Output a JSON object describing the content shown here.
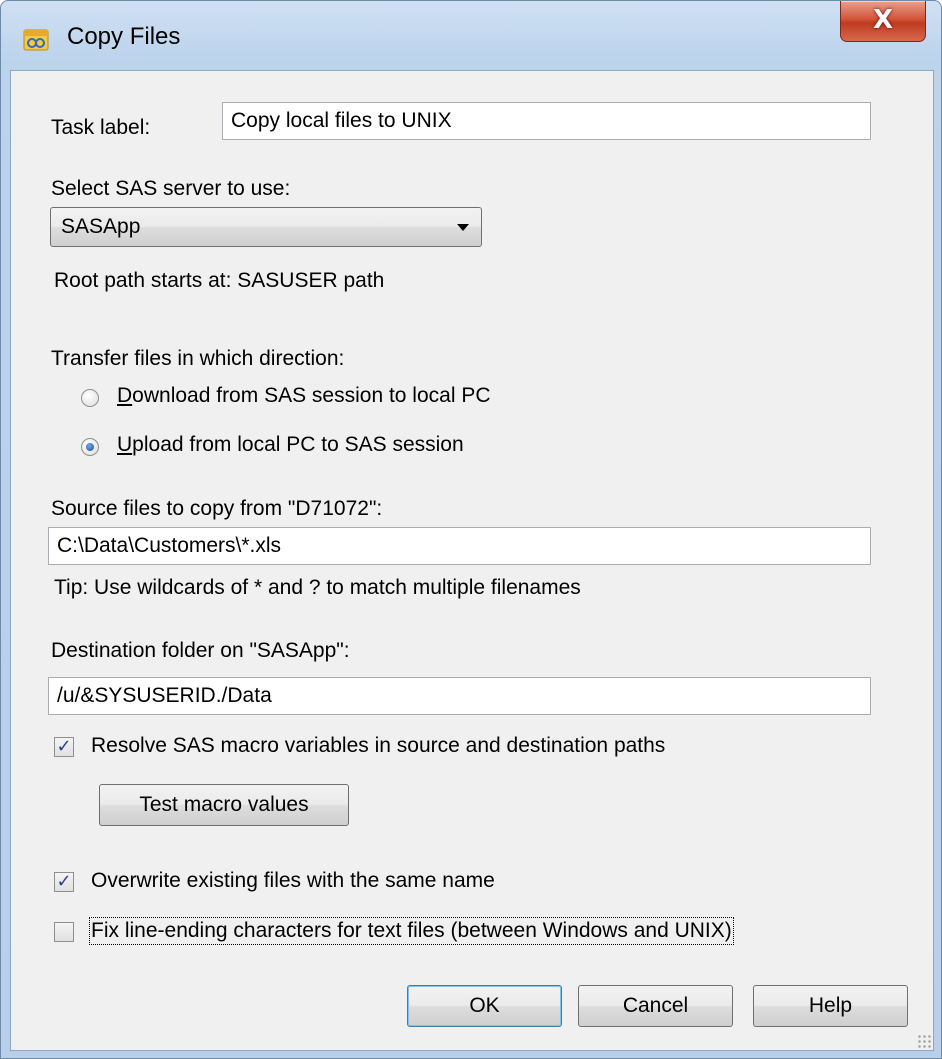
{
  "window": {
    "title": "Copy Files",
    "close_glyph": "X"
  },
  "task_label": {
    "label": "Task label:",
    "value": "Copy local files to UNIX"
  },
  "server": {
    "label": "Select SAS server to use:",
    "selected": "SASApp",
    "root_path_note": "Root path starts at: SASUSER path"
  },
  "direction": {
    "label": "Transfer files in which direction:",
    "options": [
      {
        "mnemonic": "D",
        "rest": "ownload from SAS session to local PC",
        "checked": false
      },
      {
        "mnemonic": "U",
        "rest": "pload from local PC to SAS session",
        "checked": true
      }
    ]
  },
  "source": {
    "label": "Source files to copy from \"D71072\":",
    "value": "C:\\Data\\Customers\\*.xls",
    "tip": "Tip: Use wildcards of * and ? to match multiple filenames"
  },
  "destination": {
    "label": "Destination folder on \"SASApp\":",
    "value": "/u/&SYSUSERID./Data"
  },
  "options": {
    "resolve_macros": {
      "label": "Resolve SAS macro variables in source and destination paths",
      "checked": true
    },
    "test_button": "Test macro values",
    "overwrite": {
      "label": "Overwrite existing files with the same name",
      "checked": true
    },
    "fix_line_endings": {
      "label": "Fix line-ending characters for text files (between Windows and UNIX)",
      "checked": false
    }
  },
  "buttons": {
    "ok": "OK",
    "cancel": "Cancel",
    "help": "Help"
  },
  "icons": {
    "title": "sas-app-icon",
    "close": "close-icon",
    "dropdown": "chevron-down-icon",
    "check": "✓"
  }
}
